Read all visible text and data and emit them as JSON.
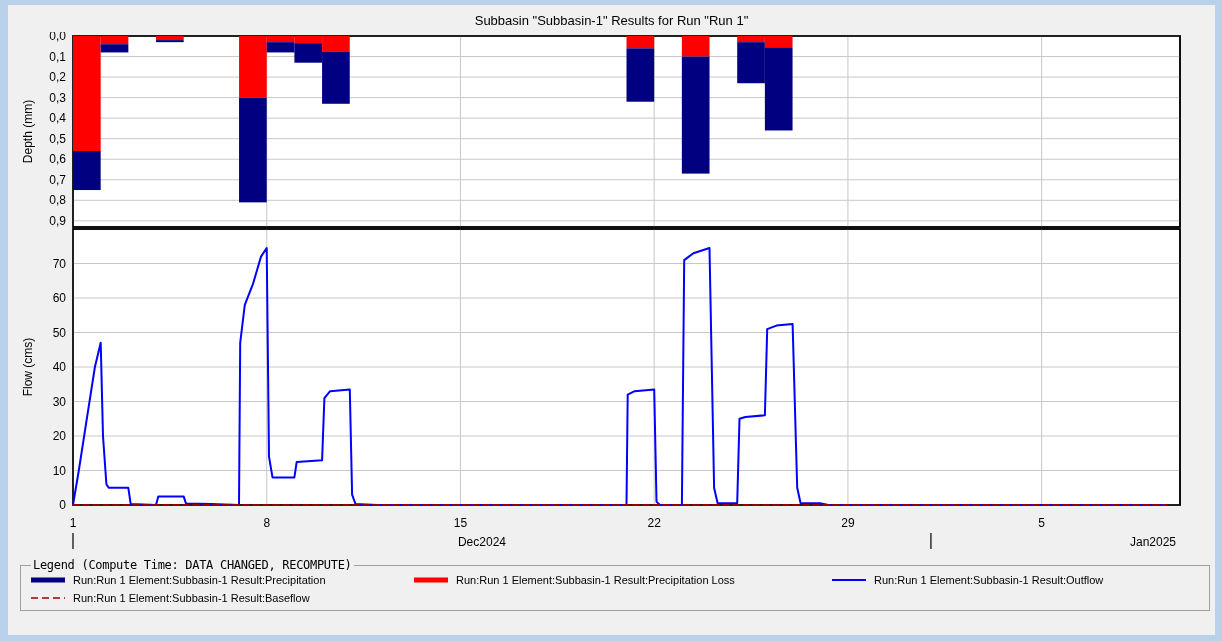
{
  "chart_title": "Subbasin \"Subbasin-1\" Results for Run \"Run 1\"",
  "depth_chart": {
    "chart_data": {
      "type": "bar",
      "stacked": true,
      "grid": true,
      "ylabel": "Depth (mm)",
      "xlim": [
        "2024-12-01 00:00",
        "2025-01-10 00:00"
      ],
      "ylim": [
        0.93,
        0
      ],
      "yticks": [
        {
          "value": 0,
          "label": "0,0"
        },
        {
          "value": 0.1,
          "label": "0,1"
        },
        {
          "value": 0.2,
          "label": "0,2"
        },
        {
          "value": 0.3,
          "label": "0,3"
        },
        {
          "value": 0.4,
          "label": "0,4"
        },
        {
          "value": 0.5,
          "label": "0,5"
        },
        {
          "value": 0.6,
          "label": "0,6"
        },
        {
          "value": 0.7,
          "label": "0,7"
        },
        {
          "value": 0.8,
          "label": "0,8"
        },
        {
          "value": 0.9,
          "label": "0,9"
        }
      ],
      "x": [
        "2024-12-01 12:00",
        "2024-12-02 12:00",
        "2024-12-04 12:00",
        "2024-12-07 12:00",
        "2024-12-08 12:00",
        "2024-12-09 12:00",
        "2024-12-10 12:00",
        "2024-12-21 12:00",
        "2024-12-23 12:00",
        "2024-12-25 12:00",
        "2024-12-26 12:00"
      ],
      "series": [
        {
          "name": "Run:Run 1 Element:Subbasin-1 Result:Precipitation Loss",
          "color": "#ff0000",
          "values": [
            0.56,
            0.04,
            0.02,
            0.3,
            0.03,
            0.035,
            0.075,
            0.06,
            0.1,
            0.03,
            0.055
          ]
        },
        {
          "name": "Run:Run 1 Element:Subbasin-1 Result:Precipitation",
          "color": "#000080",
          "values": [
            0.19,
            0.04,
            0.01,
            0.51,
            0.05,
            0.095,
            0.255,
            0.26,
            0.57,
            0.2,
            0.405
          ]
        }
      ]
    }
  },
  "flow_chart": {
    "chart_data": {
      "type": "line",
      "grid": true,
      "ylabel": "Flow (cms)",
      "xlim": [
        "2024-12-01 00:00",
        "2025-01-10 00:00"
      ],
      "ylim": [
        0,
        80
      ],
      "xticks": [
        {
          "value": "2024-12-01 00:00",
          "label": "1"
        },
        {
          "value": "2024-12-08 00:00",
          "label": "8"
        },
        {
          "value": "2024-12-15 00:00",
          "label": "15"
        },
        {
          "value": "2024-12-22 00:00",
          "label": "22"
        },
        {
          "value": "2024-12-29 00:00",
          "label": "29"
        },
        {
          "value": "2025-01-05 00:00",
          "label": "5"
        }
      ],
      "yticks": [
        0,
        10,
        20,
        30,
        40,
        50,
        60,
        70
      ],
      "x": [
        "2024-12-01 00:00",
        "2024-12-01 05:00",
        "2024-12-01 12:00",
        "2024-12-01 19:00",
        "2024-12-02 00:00",
        "2024-12-02 02:00",
        "2024-12-02 05:00",
        "2024-12-02 07:00",
        "2024-12-03 00:00",
        "2024-12-03 02:00",
        "2024-12-04 00:00",
        "2024-12-04 02:00",
        "2024-12-05 00:00",
        "2024-12-05 02:00",
        "2024-12-06 00:00",
        "2024-12-07 00:00",
        "2024-12-07 01:00",
        "2024-12-07 05:00",
        "2024-12-07 12:00",
        "2024-12-07 19:00",
        "2024-12-08 00:00",
        "2024-12-08 02:00",
        "2024-12-08 05:00",
        "2024-12-09 00:00",
        "2024-12-09 02:00",
        "2024-12-10 00:00",
        "2024-12-10 02:00",
        "2024-12-10 07:00",
        "2024-12-11 00:00",
        "2024-12-11 02:00",
        "2024-12-11 05:00",
        "2024-12-12 00:00",
        "2024-12-21 00:00",
        "2024-12-21 01:00",
        "2024-12-21 07:00",
        "2024-12-22 00:00",
        "2024-12-22 02:00",
        "2024-12-22 05:00",
        "2024-12-23 00:00",
        "2024-12-23 02:00",
        "2024-12-23 10:00",
        "2024-12-24 00:00",
        "2024-12-24 04:00",
        "2024-12-24 07:00",
        "2024-12-25 00:00",
        "2024-12-25 02:00",
        "2024-12-25 07:00",
        "2024-12-26 00:00",
        "2024-12-26 02:00",
        "2024-12-26 10:00",
        "2024-12-27 00:00",
        "2024-12-27 04:00",
        "2024-12-27 07:00",
        "2024-12-28 00:00",
        "2024-12-28 07:00",
        "2025-01-09 12:00"
      ],
      "series": [
        {
          "name": "Run:Run 1 Element:Subbasin-1 Result:Outflow",
          "color": "#0000ff",
          "values": [
            0,
            10,
            25,
            40,
            47,
            20,
            6,
            5,
            5,
            0.3,
            0,
            2.5,
            2.5,
            0.4,
            0.3,
            0,
            47,
            58,
            64,
            72,
            74.5,
            14,
            8,
            8,
            12.5,
            13,
            31,
            33,
            33.5,
            3,
            0.3,
            0,
            0,
            32,
            33,
            33.5,
            1,
            0,
            0,
            71,
            73,
            74.5,
            5,
            0.5,
            0.5,
            25,
            25.5,
            26,
            51,
            52,
            52.5,
            5,
            0.5,
            0.5,
            0,
            0
          ]
        },
        {
          "name": "Run:Run 1 Element:Subbasin-1 Result:Baseflow",
          "color": "#990000",
          "line_style": "dashed",
          "values": [
            0,
            0,
            0,
            0,
            0,
            0,
            0,
            0,
            0,
            0,
            0,
            0,
            0,
            0,
            0,
            0,
            0,
            0,
            0,
            0,
            0,
            0,
            0,
            0,
            0,
            0,
            0,
            0,
            0,
            0,
            0,
            0,
            0,
            0,
            0,
            0,
            0,
            0,
            0,
            0,
            0,
            0,
            0,
            0,
            0,
            0,
            0,
            0,
            0,
            0,
            0,
            0,
            0,
            0,
            0,
            0
          ]
        }
      ]
    },
    "period_labels": [
      "Dec2024",
      "Jan2025"
    ]
  },
  "legend": {
    "title": "Legend (Compute Time: DATA CHANGED, RECOMPUTE)"
  }
}
